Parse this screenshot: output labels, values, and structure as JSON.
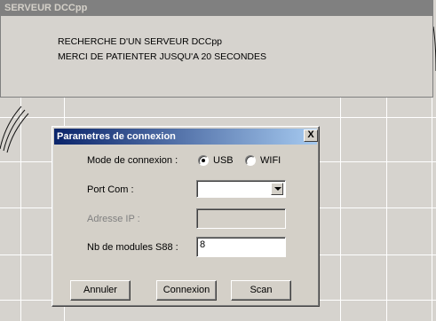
{
  "server_window": {
    "title": "SERVEUR DCCpp",
    "line1": "RECHERCHE D'UN SERVEUR DCCpp",
    "line2": "MERCI DE PATIENTER JUSQU'A 20 SECONDES"
  },
  "dialog": {
    "title": "Parametres de connexion",
    "close_label": "X",
    "mode_label": "Mode de connexion :",
    "mode_options": [
      {
        "label": "USB",
        "selected": true
      },
      {
        "label": "WIFI",
        "selected": false
      }
    ],
    "port_label": "Port Com :",
    "port_value": "",
    "ip_label": "Adresse IP :",
    "ip_value": "",
    "s88_label": "Nb de modules S88 :",
    "s88_value": "8",
    "buttons": {
      "cancel": "Annuler",
      "connect": "Connexion",
      "scan": "Scan"
    }
  }
}
